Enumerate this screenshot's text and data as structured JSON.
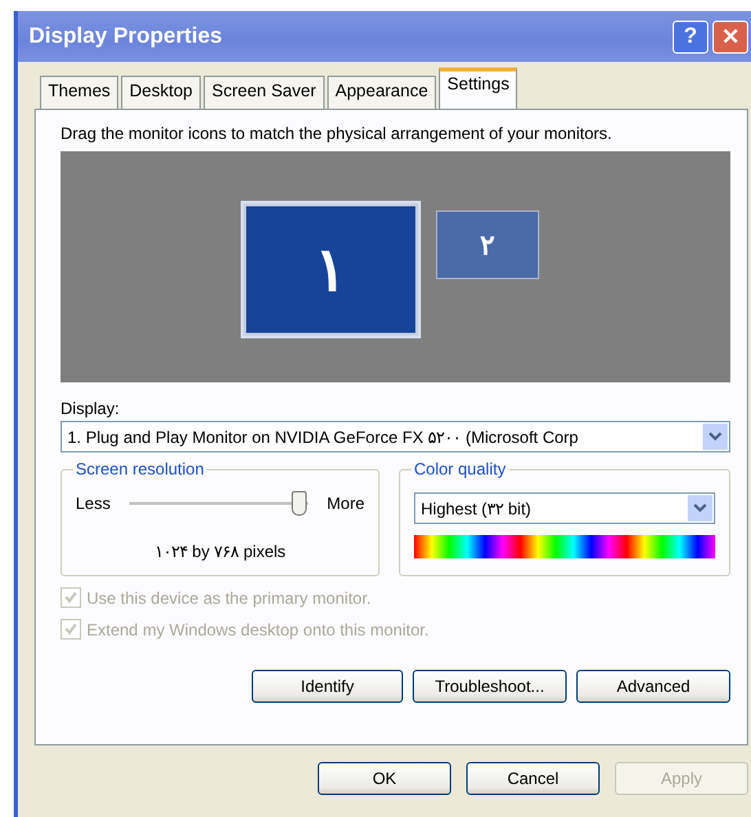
{
  "window": {
    "title": "Display Properties",
    "help": "?",
    "close": "✕"
  },
  "tabs": [
    {
      "label": "Themes",
      "selected": false
    },
    {
      "label": "Desktop",
      "selected": false
    },
    {
      "label": "Screen Saver",
      "selected": false
    },
    {
      "label": "Appearance",
      "selected": false
    },
    {
      "label": "Settings",
      "selected": true
    }
  ],
  "instruction": "Drag the monitor icons to match the physical arrangement of your monitors.",
  "monitors": [
    {
      "label": "۱",
      "selected": true
    },
    {
      "label": "۲",
      "selected": false
    }
  ],
  "display": {
    "label": "Display:",
    "value": "1. Plug and Play Monitor on NVIDIA GeForce FX ۵۲۰۰  (Microsoft Corp"
  },
  "screen_resolution": {
    "title": "Screen resolution",
    "less": "Less",
    "more": "More",
    "level": 0.95,
    "reading": "۱۰۲۴ by ۷۶۸ pixels"
  },
  "color_quality": {
    "title": "Color quality",
    "value": "Highest (۳۲ bit)"
  },
  "options": [
    {
      "label": "Use this device as the primary monitor.",
      "checked": true,
      "disabled": true
    },
    {
      "label": "Extend my Windows desktop onto this monitor.",
      "checked": true,
      "disabled": true
    }
  ],
  "panel_buttons": [
    "Identify",
    "Troubleshoot...",
    "Advanced"
  ],
  "dialog_buttons": [
    {
      "label": "OK",
      "disabled": false
    },
    {
      "label": "Cancel",
      "disabled": false
    },
    {
      "label": "Apply",
      "disabled": true
    }
  ]
}
